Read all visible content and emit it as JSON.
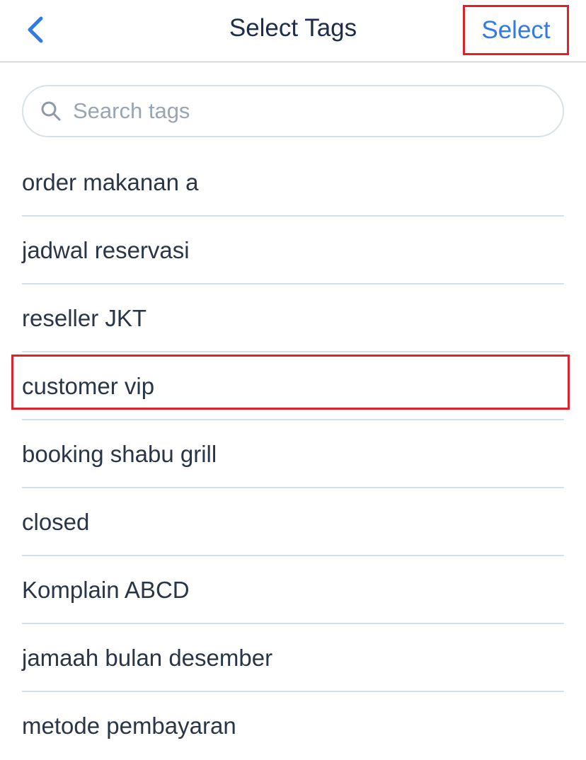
{
  "nav": {
    "back_icon": "chevron-left-icon",
    "title": "Select Tags",
    "select_label": "Select",
    "accent_color": "#2f7be8"
  },
  "search": {
    "icon": "search-icon",
    "placeholder": "Search tags",
    "value": ""
  },
  "tags": [
    {
      "label": "order makanan a"
    },
    {
      "label": "jadwal reservasi"
    },
    {
      "label": "reseller JKT"
    },
    {
      "label": "customer vip"
    },
    {
      "label": "booking shabu grill"
    },
    {
      "label": "closed"
    },
    {
      "label": "Komplain ABCD"
    },
    {
      "label": "jamaah bulan desember"
    },
    {
      "label": "metode pembayaran"
    }
  ],
  "annotation": {
    "color": "#e0202a",
    "highlighted_items": [
      "Select",
      "customer vip"
    ]
  }
}
